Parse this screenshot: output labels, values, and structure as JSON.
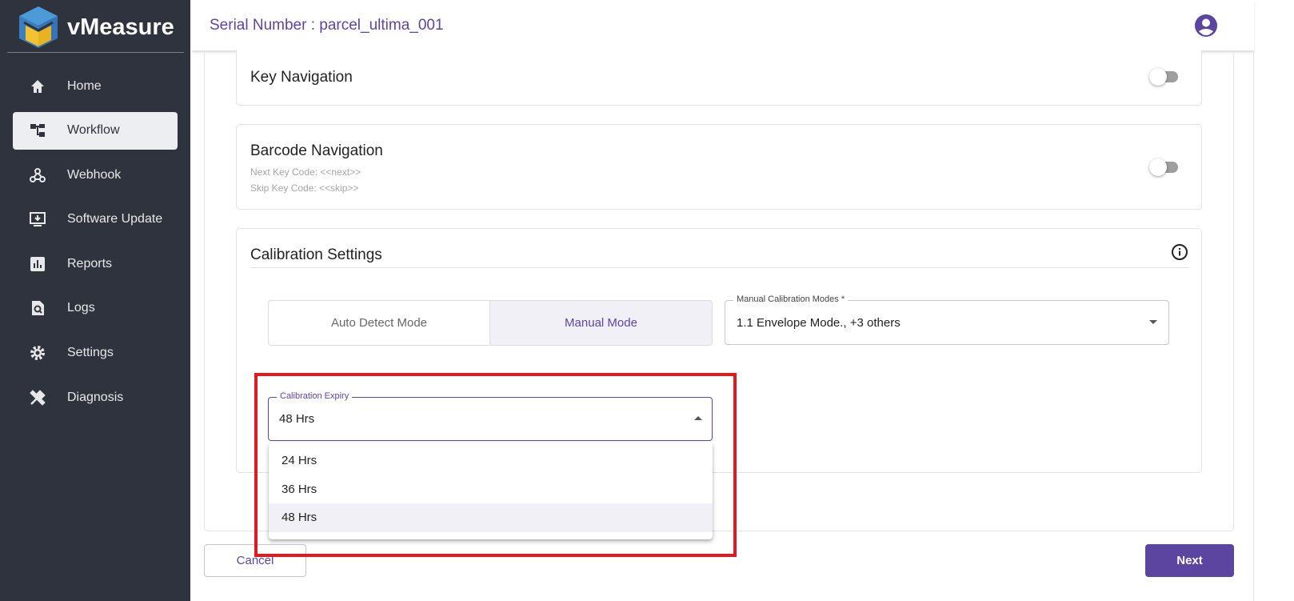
{
  "app": {
    "name": "vMeasure"
  },
  "sidebar": {
    "items": [
      {
        "label": "Home",
        "icon": "home-icon"
      },
      {
        "label": "Workflow",
        "icon": "workflow-icon",
        "active": true
      },
      {
        "label": "Webhook",
        "icon": "webhook-icon"
      },
      {
        "label": "Software Update",
        "icon": "software-update-icon"
      },
      {
        "label": "Reports",
        "icon": "reports-icon"
      },
      {
        "label": "Logs",
        "icon": "logs-icon"
      },
      {
        "label": "Settings",
        "icon": "gear-icon"
      },
      {
        "label": "Diagnosis",
        "icon": "tools-icon"
      }
    ]
  },
  "header": {
    "serial": "Serial Number : parcel_ultima_001"
  },
  "key_nav": {
    "title": "Key Navigation",
    "enabled": false
  },
  "barcode_nav": {
    "title": "Barcode Navigation",
    "next": "Next Key Code: <<next>>",
    "skip": "Skip Key Code: <<skip>>",
    "enabled": false
  },
  "calibration": {
    "title": "Calibration Settings",
    "modes": [
      "Auto Detect Mode",
      "Manual Mode"
    ],
    "selected_mode": "Manual Mode",
    "manual_modes_label": "Manual Calibration Modes *",
    "manual_modes_value": "1.1 Envelope Mode., +3 others",
    "expiry_label": "Calibration Expiry",
    "expiry_value": "48 Hrs",
    "expiry_options": [
      "24 Hrs",
      "36 Hrs",
      "48 Hrs"
    ]
  },
  "footer": {
    "cancel": "Cancel",
    "next": "Next"
  },
  "colors": {
    "accent": "#5c45a0",
    "sidebar": "#2e333d",
    "highlight": "#e01a1f"
  }
}
